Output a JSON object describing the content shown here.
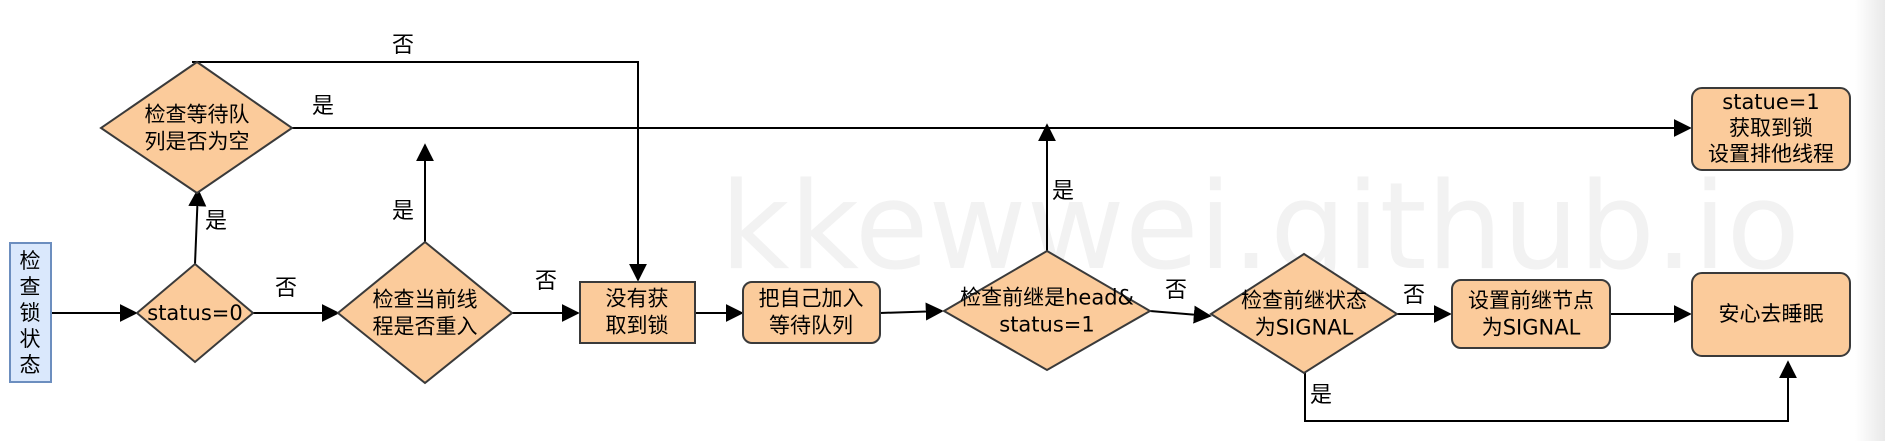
{
  "watermark": "kkewwei.github.io",
  "colors": {
    "node_fill": "#fbcb9b",
    "node_stroke": "#3a3a3a",
    "start_fill": "#dae8fc",
    "start_stroke": "#6c8ebf",
    "line": "#000000"
  },
  "nodes": {
    "start": "检\n查\n锁\n状\n态",
    "status_zero": "status=0",
    "check_queue_empty": "检查等待队\n列是否为空",
    "check_reentrant": "检查当前线\n程是否重入",
    "not_acquired": "没有获\n取到锁",
    "join_queue": "把自己加入\n等待队列",
    "check_pred_head": "检查前继是head&\nstatus=1",
    "check_pred_signal": "检查前继状态\n为SIGNAL",
    "set_pred_signal": "设置前继节点\n为SIGNAL",
    "sleep": "安心去睡眠",
    "acquired": "statue=1\n获取到锁\n设置排他线程"
  },
  "edge_labels": {
    "queue_no": "否",
    "queue_yes": "是",
    "status_yes": "是",
    "status_no": "否",
    "reentrant_yes": "是",
    "reentrant_no": "否",
    "head_yes": "是",
    "head_no": "否",
    "signal_no": "否",
    "signal_yes": "是"
  }
}
